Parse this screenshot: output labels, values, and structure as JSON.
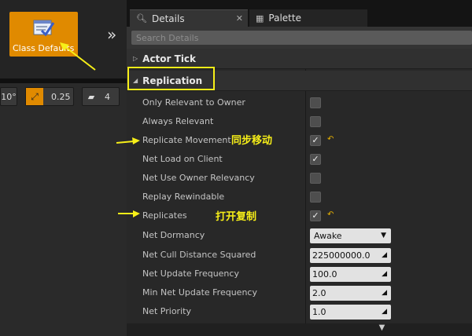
{
  "class_defaults": {
    "label": "Class Defaults"
  },
  "toolbar": {
    "chevron": "»",
    "rotation_value": "10°",
    "scale_value": "0.25",
    "camera_speed": "4"
  },
  "tabs": [
    {
      "label": "Details",
      "icon": "magnifier-icon",
      "close": "✕"
    },
    {
      "label": "Palette",
      "icon": "grid-icon",
      "close": ""
    }
  ],
  "search": {
    "placeholder": "Search Details",
    "value": ""
  },
  "categories": {
    "actor_tick": "Actor Tick",
    "replication": "Replication"
  },
  "properties": {
    "only_relevant_to_owner": {
      "label": "Only Relevant to Owner",
      "checked": false
    },
    "always_relevant": {
      "label": "Always Relevant",
      "checked": false
    },
    "replicate_movement": {
      "label": "Replicate Movement",
      "checked": true
    },
    "net_load_on_client": {
      "label": "Net Load on Client",
      "checked": true
    },
    "net_use_owner_relevancy": {
      "label": "Net Use Owner Relevancy",
      "checked": false
    },
    "replay_rewindable": {
      "label": "Replay Rewindable",
      "checked": false
    },
    "replicates": {
      "label": "Replicates",
      "checked": true
    },
    "net_dormancy": {
      "label": "Net Dormancy",
      "value": "Awake"
    },
    "net_cull_distance_squared": {
      "label": "Net Cull Distance Squared",
      "value": "225000000.0"
    },
    "net_update_frequency": {
      "label": "Net Update Frequency",
      "value": "100.0"
    },
    "min_net_update_frequency": {
      "label": "Min Net Update Frequency",
      "value": "2.0"
    },
    "net_priority": {
      "label": "Net Priority",
      "value": "1.0"
    }
  },
  "glyphs": {
    "check": "✓",
    "reset": "↶",
    "dropdown": "▼",
    "expand_collapsed": "▷",
    "expand_open": "◢"
  },
  "annotations": {
    "replicate_movement_note": "同步移动",
    "replicates_note": "打开复制"
  },
  "colors": {
    "highlight": "#f7ef18",
    "accent_orange": "#e08a00",
    "panel_bg": "#282828",
    "category_bg": "#303030"
  }
}
